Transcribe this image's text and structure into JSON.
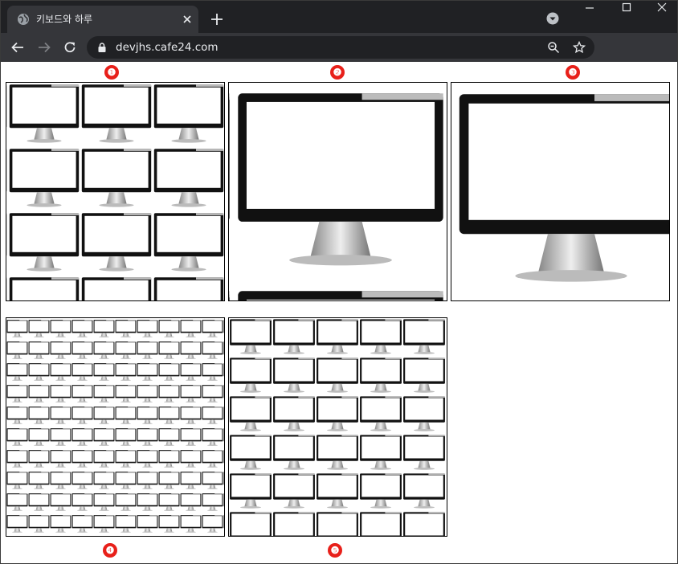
{
  "browser": {
    "tab": {
      "title": "키보드와 하루",
      "favicon": "globe-icon"
    },
    "address_bar": {
      "url": "devjhs.cafe24.com"
    },
    "icons": [
      "back-arrow-icon",
      "forward-arrow-icon",
      "reload-icon",
      "lock-icon",
      "zoom-icon",
      "star-icon",
      "new-tab-plus-icon",
      "profile-dropdown-icon",
      "minimize-icon",
      "maximize-icon",
      "close-icon"
    ]
  },
  "examples": [
    {
      "label": "❶",
      "image": "monitor-icon"
    },
    {
      "label": "❷",
      "image": "monitor-icon"
    },
    {
      "label": "❸",
      "image": "monitor-icon"
    },
    {
      "label": "❹",
      "image": "monitor-icon"
    },
    {
      "label": "❺",
      "image": "monitor-icon"
    }
  ],
  "colors": {
    "badge": "#e8201a",
    "chrome_dark": "#202124",
    "chrome_toolbar": "#35363a"
  }
}
